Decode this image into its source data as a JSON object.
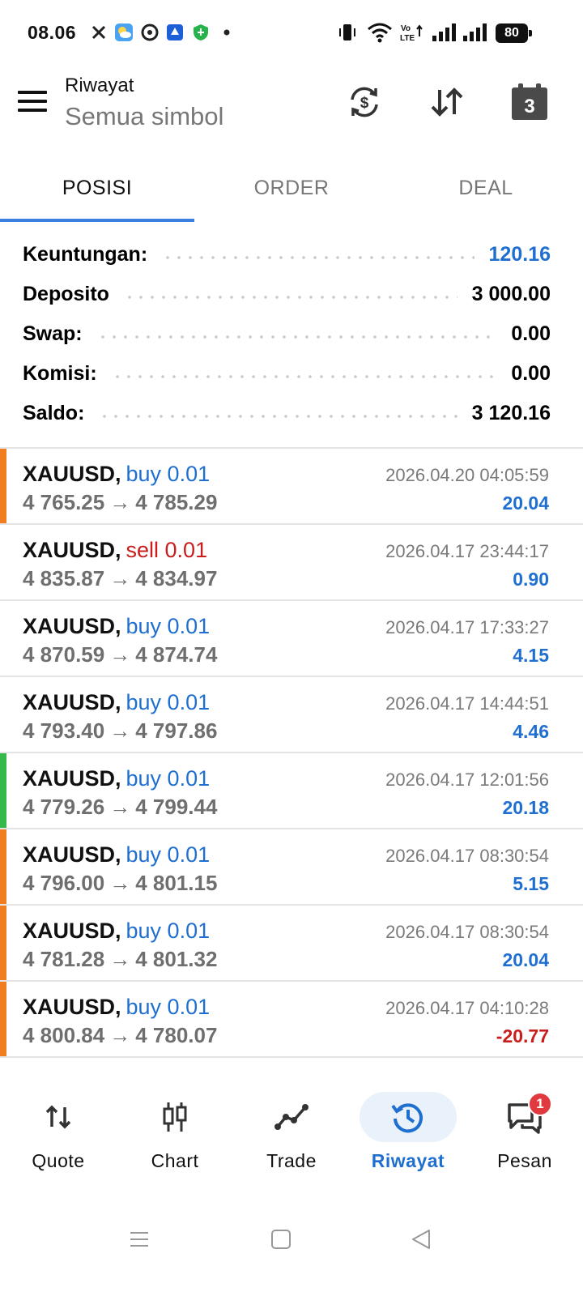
{
  "status_bar": {
    "time": "08.06",
    "battery": "80",
    "icons": [
      "x-icon",
      "weather-icon",
      "circle-app-icon",
      "app-icon",
      "shield-icon",
      "dot-icon",
      "vibrate-icon",
      "wifi-icon",
      "volte-icon",
      "signal-icon",
      "signal-icon"
    ]
  },
  "app_bar": {
    "title": "Riwayat",
    "subtitle": "Semua simbol",
    "calendar_day": "3"
  },
  "tabs": [
    {
      "label": "POSISI",
      "active": true
    },
    {
      "label": "ORDER",
      "active": false
    },
    {
      "label": "DEAL",
      "active": false
    }
  ],
  "summary": [
    {
      "label": "Keuntungan:",
      "value": "120.16"
    },
    {
      "label": "Deposito",
      "value": "3 000.00"
    },
    {
      "label": "Swap:",
      "value": "0.00"
    },
    {
      "label": "Komisi:",
      "value": "0.00"
    },
    {
      "label": "Saldo:",
      "value": "3 120.16"
    }
  ],
  "deals": [
    {
      "symbol": "XAUUSD,",
      "side": "buy 0.01",
      "open": "4 765.25",
      "arrow": "→",
      "close": "4 785.29",
      "time": "2026.04.20 04:05:59",
      "profit": "20.04",
      "marker": "orange"
    },
    {
      "symbol": "XAUUSD,",
      "side": "sell 0.01",
      "open": "4 835.87",
      "arrow": "→",
      "close": "4 834.97",
      "time": "2026.04.17 23:44:17",
      "profit": "0.90",
      "marker": "none"
    },
    {
      "symbol": "XAUUSD,",
      "side": "buy 0.01",
      "open": "4 870.59",
      "arrow": "→",
      "close": "4 874.74",
      "time": "2026.04.17 17:33:27",
      "profit": "4.15",
      "marker": "none"
    },
    {
      "symbol": "XAUUSD,",
      "side": "buy 0.01",
      "open": "4 793.40",
      "arrow": "→",
      "close": "4 797.86",
      "time": "2026.04.17 14:44:51",
      "profit": "4.46",
      "marker": "none"
    },
    {
      "symbol": "XAUUSD,",
      "side": "buy 0.01",
      "open": "4 779.26",
      "arrow": "→",
      "close": "4 799.44",
      "time": "2026.04.17 12:01:56",
      "profit": "20.18",
      "marker": "green"
    },
    {
      "symbol": "XAUUSD,",
      "side": "buy 0.01",
      "open": "4 796.00",
      "arrow": "→",
      "close": "4 801.15",
      "time": "2026.04.17 08:30:54",
      "profit": "5.15",
      "marker": "orange"
    },
    {
      "symbol": "XAUUSD,",
      "side": "buy 0.01",
      "open": "4 781.28",
      "arrow": "→",
      "close": "4 801.32",
      "time": "2026.04.17 08:30:54",
      "profit": "20.04",
      "marker": "orange"
    },
    {
      "symbol": "XAUUSD,",
      "side": "buy 0.01",
      "open": "4 800.84",
      "arrow": "→",
      "close": "4 780.07",
      "time": "2026.04.17 04:10:28",
      "profit": "-20.77",
      "marker": "orange"
    }
  ],
  "bottom_nav": [
    {
      "label": "Quote",
      "icon": "quote-icon",
      "active": false
    },
    {
      "label": "Chart",
      "icon": "chart-icon",
      "active": false
    },
    {
      "label": "Trade",
      "icon": "trade-icon",
      "active": false
    },
    {
      "label": "Riwayat",
      "icon": "history-icon",
      "active": true
    },
    {
      "label": "Pesan",
      "icon": "messages-icon",
      "active": false,
      "badge": "1"
    }
  ],
  "colors": {
    "accent": "#1f6fd0",
    "loss": "#c91c1c",
    "marker_orange": "#f07e20",
    "marker_green": "#36b84a",
    "tab_indicator": "#3a7fdb"
  }
}
